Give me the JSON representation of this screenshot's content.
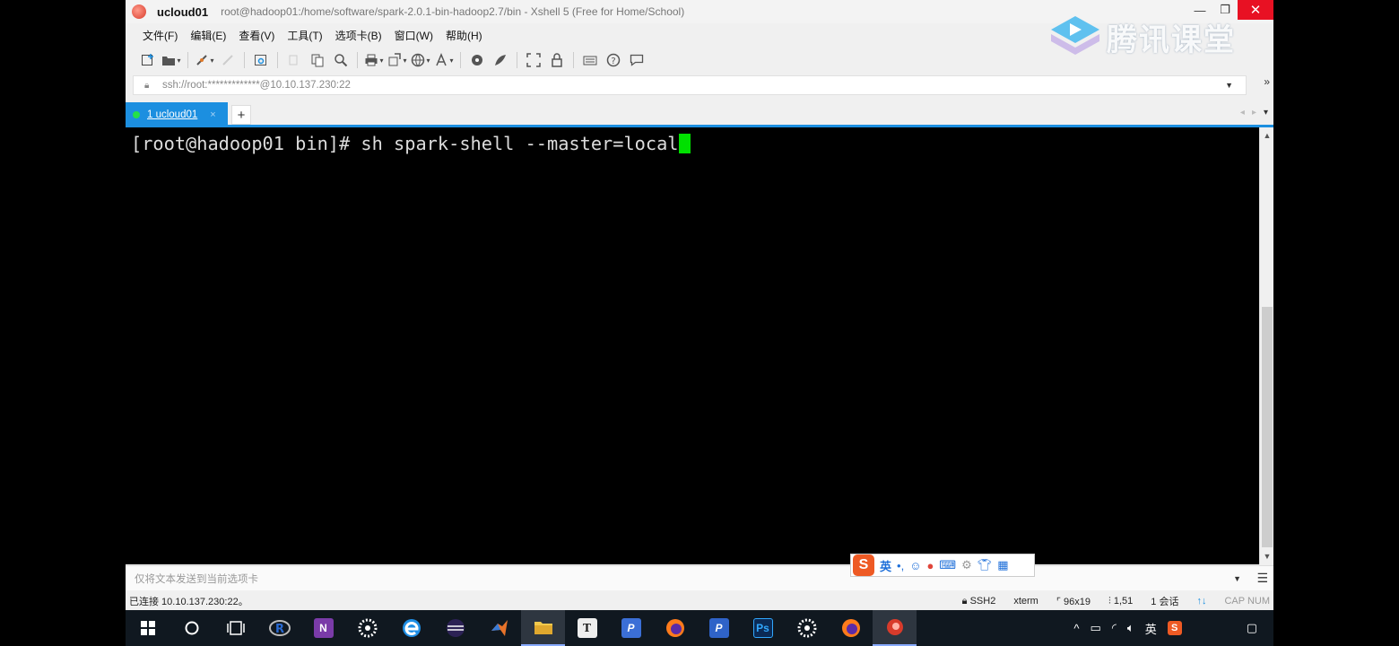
{
  "window": {
    "session_name": "ucloud01",
    "title_path": "root@hadoop01:/home/software/spark-2.0.1-bin-hadoop2.7/bin - Xshell 5 (Free for Home/School)",
    "minimize_glyph": "—",
    "restore_glyph": "❐",
    "close_glyph": "✕"
  },
  "menu": [
    "文件(F)",
    "编辑(E)",
    "查看(V)",
    "工具(T)",
    "选项卡(B)",
    "窗口(W)",
    "帮助(H)"
  ],
  "address": {
    "value": "ssh://root:*************@10.10.137.230:22"
  },
  "tabs": [
    {
      "label": "1 ucloud01",
      "close": "×"
    }
  ],
  "tab_add": "+",
  "terminal": {
    "prompt": "[root@hadoop01 bin]# ",
    "command": "sh spark-shell --master=local"
  },
  "compose": {
    "placeholder": "仅将文本发送到当前选项卡"
  },
  "status": {
    "connection": "已连接 10.10.137.230:22。",
    "protocol": "SSH2",
    "term": "xterm",
    "size": "96x19",
    "position": "1,51",
    "sessions": "1 会话",
    "caps": "CAP",
    "num": "NUM"
  },
  "ime": {
    "brand": "S",
    "lang": "英",
    "punct": "•,",
    "icons": [
      "smile-icon",
      "mic-icon",
      "keyboard-icon",
      "tools-icon",
      "shirt-icon",
      "grid-icon"
    ]
  },
  "watermark": {
    "text": "腾讯课堂"
  },
  "tray": {
    "lang": "英"
  },
  "colors": {
    "tab_accent": "#1c8fe0",
    "cursor": "#00e000",
    "close_red": "#e81123",
    "ime_orange": "#ee5a24"
  }
}
